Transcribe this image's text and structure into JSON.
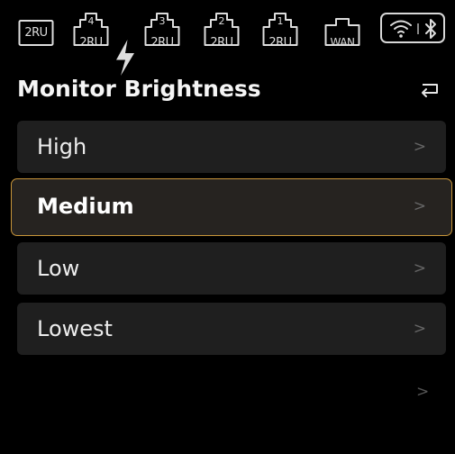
{
  "status_bar": {
    "ports": [
      {
        "tag": "2RU",
        "number": ""
      },
      {
        "tag": "2RU",
        "number": "4",
        "icon": "bolt"
      },
      {
        "tag": "2RU",
        "number": "3"
      },
      {
        "tag": "2RU",
        "number": "2"
      },
      {
        "tag": "2RU",
        "number": "1"
      },
      {
        "tag": "WAN",
        "number": ""
      }
    ],
    "wireless_icons": [
      "wifi-icon",
      "bluetooth-icon"
    ]
  },
  "header": {
    "title": "Monitor Brightness",
    "back_icon": "back-arrow-icon"
  },
  "menu": {
    "items": [
      {
        "label": "High",
        "selected": false
      },
      {
        "label": "Medium",
        "selected": true
      },
      {
        "label": "Low",
        "selected": false
      },
      {
        "label": "Lowest",
        "selected": false
      }
    ],
    "chevron": ">"
  },
  "colors": {
    "background": "#000000",
    "item_bg": "#1f1f1f",
    "selected_border": "#c9963a",
    "text": "#ececec"
  }
}
